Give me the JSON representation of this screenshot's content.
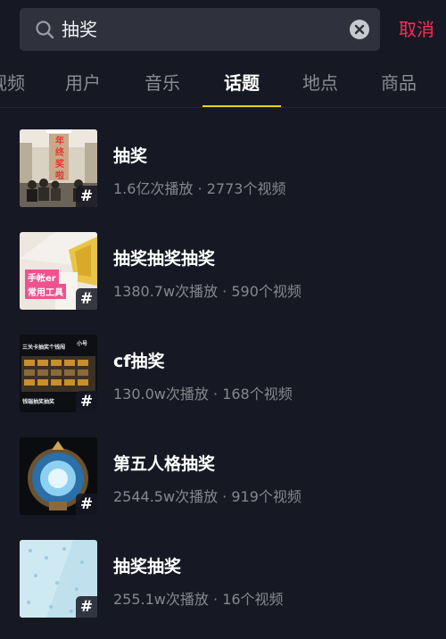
{
  "search": {
    "query": "抽奖",
    "cancel_label": "取消"
  },
  "tabs": [
    {
      "label": "视频"
    },
    {
      "label": "用户"
    },
    {
      "label": "音乐"
    },
    {
      "label": "话题",
      "active": true
    },
    {
      "label": "地点"
    },
    {
      "label": "商品"
    }
  ],
  "colors": {
    "background": "#161823",
    "accent_red": "#fe2c55",
    "active_tab_underline": "#face15",
    "muted_text": "#86878e"
  },
  "results": [
    {
      "title": "抽奖",
      "plays": "1.6亿次播放",
      "separator": "·",
      "videos": "2773个视频",
      "thumb_text": [
        "年",
        "终",
        "奖",
        "啦"
      ],
      "hash": "#"
    },
    {
      "title": "抽奖抽奖抽奖",
      "plays": "1380.7w次播放",
      "separator": "·",
      "videos": "590个视频",
      "thumb_text": [
        "手帐er",
        "常用工具"
      ],
      "hash": "#"
    },
    {
      "title": "cf抽奖",
      "plays": "130.0w次播放",
      "separator": "·",
      "videos": "168个视频",
      "thumb_text": [
        "三关卡抽奖个钱闯",
        "小号",
        "钱端抽奖抽奖"
      ],
      "hash": "#"
    },
    {
      "title": "第五人格抽奖",
      "plays": "2544.5w次播放",
      "separator": "·",
      "videos": "919个视频",
      "hash": "#"
    },
    {
      "title": "抽奖抽奖",
      "plays": "255.1w次播放",
      "separator": "·",
      "videos": "16个视频",
      "hash": "#"
    }
  ]
}
